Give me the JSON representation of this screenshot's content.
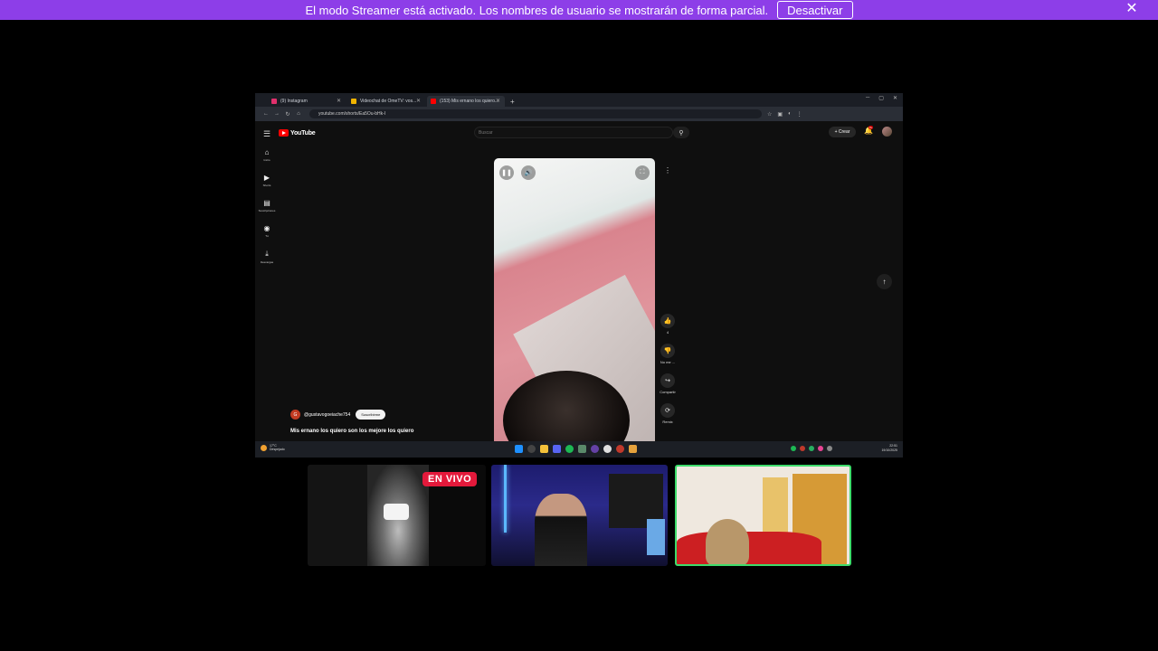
{
  "banner": {
    "text": "El modo Streamer está activado. Los nombres de usuario se mostrarán de forma parcial.",
    "button_label": "Desactivar",
    "close_glyph": "✕"
  },
  "browser": {
    "tabs": [
      {
        "label": "(9) Instagram",
        "favicon_color": "#e1306c"
      },
      {
        "label": "Videochat de OmeTV: vos...",
        "favicon_color": "#f0b400"
      },
      {
        "label": "(153) Mis ernano los quiero...",
        "favicon_color": "#ff0000"
      }
    ],
    "url": "youtube.com/shorts/Ea5Ou-bHk-I"
  },
  "youtube": {
    "logo_text": "YouTube",
    "search_placeholder": "Buscar",
    "create_label": "Crear",
    "notifications_badge": "9+",
    "sidebar": [
      {
        "icon": "home-icon",
        "glyph": "⌂",
        "label": "Inicio"
      },
      {
        "icon": "shorts-icon",
        "glyph": "▶",
        "label": "Shorts"
      },
      {
        "icon": "subscriptions-icon",
        "glyph": "▤",
        "label": "Suscripciones"
      },
      {
        "icon": "you-icon",
        "glyph": "◉",
        "label": "Tú"
      },
      {
        "icon": "downloads-icon",
        "glyph": "⤓",
        "label": "Descargas"
      }
    ],
    "short": {
      "channel_initial": "G",
      "channel_name": "@gustavogoeiache754",
      "subscribe_label": "Suscribirme",
      "title": "Mis ernano los quiero son los mejore los quiero",
      "actions": [
        {
          "icon": "like-icon",
          "glyph": "👍",
          "label": "4"
        },
        {
          "icon": "dislike-icon",
          "glyph": "👎",
          "label": "No me ..."
        },
        {
          "icon": "share-icon",
          "glyph": "↪",
          "label": "Compartir"
        },
        {
          "icon": "remix-icon",
          "glyph": "⟳",
          "label": "Remix"
        }
      ]
    }
  },
  "taskbar": {
    "weather_temp": "17°C",
    "weather_desc": "Despejado",
    "time": "22:51",
    "date": "19/10/2025"
  },
  "cams": {
    "live_label": "EN VIVO"
  }
}
